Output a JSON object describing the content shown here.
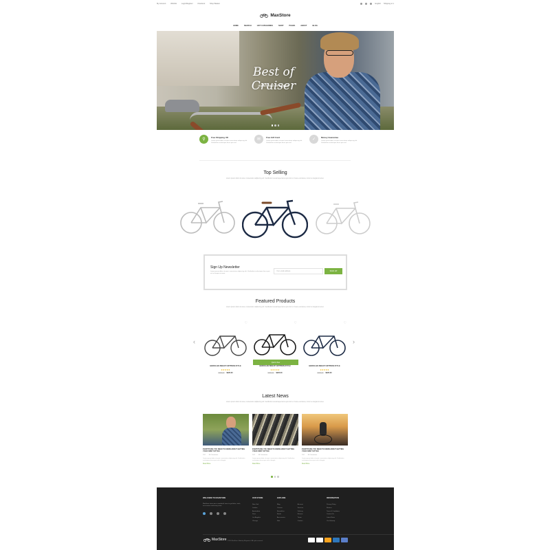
{
  "topbar": {
    "links": [
      "My Account",
      "Wishlist",
      "Login/Register",
      "Checkout",
      "Shop Basket"
    ],
    "language": "English",
    "currency": "Shipping to ▾"
  },
  "brand": {
    "name": "MaxStore"
  },
  "nav": [
    "HOME",
    "SEARCH",
    "HOT CATEGORIES",
    "SHOP",
    "PAGES",
    "ABOUT",
    "BLOG"
  ],
  "hero": {
    "title": "Best of Cruiser",
    "subtitle": "GOING FAST IS GREAT!"
  },
  "features": [
    {
      "icon": "bike-icon",
      "title": "Free Shipping UK",
      "desc": "Lorem ipsum dolor sit amet consectetur adipiscing elit. Vestibulum scelerisque lacus quis nisl."
    },
    {
      "icon": "gift-icon",
      "title": "Free Gift Card",
      "desc": "Lorem ipsum dolor sit amet consectetur adipiscing elit. Vestibulum scelerisque lacus quis nisl."
    },
    {
      "icon": "shield-icon",
      "title": "Money Guarantee",
      "desc": "Lorem ipsum dolor sit amet consectetur adipiscing elit. Vestibulum scelerisque lacus quis nisl."
    }
  ],
  "top_selling": {
    "title": "Top Selling",
    "desc": "Lorem ipsum dolor sit amet, consectetur adipiscing elit. Vestibulum scelerisque lacus quis nisl ut. Fusce erat lacus, rutrum a feugiat sit amet."
  },
  "newsletter": {
    "title": "Sign Up Newsletter",
    "desc": "Lorem ipsum dolor sit amet, consectetur adipiscing elit. Vestibulum scelerisque lacus quis nisl ut feugiat sit amet.",
    "placeholder": "Your email address",
    "button": "SIGN UP"
  },
  "featured": {
    "title": "Featured Products",
    "desc": "Lorem ipsum dolor sit amet, consectetur adipiscing elit. Vestibulum scelerisque lacus quis nisl ut. Fusce erat lacus, rutrum a feugiat sit amet.",
    "quick_view": "Quick View",
    "products": [
      {
        "name": "HERCULES BIKE BY MITTRON STYLE",
        "stars": "★★★★★",
        "old_price": "$290.00",
        "new_price": "$220.00"
      },
      {
        "name": "HERCULES BIKE BY MITTRON STYLE",
        "stars": "★★★★★",
        "old_price": "$290.00",
        "new_price": "$220.00"
      },
      {
        "name": "HERCULES BIKE BY MITTRON STYLE",
        "stars": "★★★★★",
        "old_price": "$290.00",
        "new_price": "$220.00"
      }
    ]
  },
  "news": {
    "title": "Latest News",
    "desc": "Lorem ipsum dolor sit amet, consectetur adipiscing elit. Vestibulum scelerisque lacus quis nisl ut. Fusce erat lacus, rutrum a feugiat sit amet.",
    "read_more": "Read More",
    "items": [
      {
        "title": "EVERYTHING YOU NEED TO KNOW ABOUT GETTING YOUR FIRST TATTOO",
        "likes": "124",
        "comments": "36 Comments",
        "desc": "Lorem ipsum dolor sit amet, consectetur adipiscing elit. Vestibulum scelerisque lacus quis nisl ut feugiat."
      },
      {
        "title": "EVERYTHING YOU NEED TO KNOW ABOUT GETTING YOUR FIRST TATTOO",
        "likes": "124",
        "comments": "36 Comments",
        "desc": "Lorem ipsum dolor sit amet, consectetur adipiscing elit. Vestibulum scelerisque lacus quis nisl ut feugiat."
      },
      {
        "title": "EVERYTHING YOU NEED TO KNOW ABOUT GETTING YOUR FIRST TATTOO",
        "likes": "124",
        "comments": "36 Comments",
        "desc": "Lorem ipsum dolor sit amet, consectetur adipiscing elit. Vestibulum scelerisque lacus quis nisl ut feugiat."
      }
    ]
  },
  "footer": {
    "welcome_title": "WELCOME TO MAXSTORE",
    "welcome_text": "MaxStore store was a wonderful store to get bikes, tools, accessories and many more.",
    "our_store": {
      "title": "OUR STORE",
      "items": [
        "New York",
        "London",
        "Amsterdam",
        "Paris",
        "Los Angeles",
        "Chicago"
      ]
    },
    "explore": {
      "title": "EXPLORE",
      "col1": [
        "Blog",
        "Careers",
        "Bestsellers",
        "Books",
        "Accessories",
        "Kids"
      ],
      "col2": [
        "Account",
        "Services",
        "Delivery",
        "Returns",
        "Terms",
        "Contact"
      ]
    },
    "information": {
      "title": "INFORMATION",
      "items": [
        "Privacy Policy",
        "Returns",
        "Terms & Conditions",
        "Contact Us",
        "Latest News",
        "Our Sitemap"
      ]
    },
    "copyright": "© 2016 MaxStore. Made by Magentech. All rights reserved."
  },
  "colors": {
    "accent": "#7cb342",
    "footer_bg": "#1f1f1f"
  }
}
